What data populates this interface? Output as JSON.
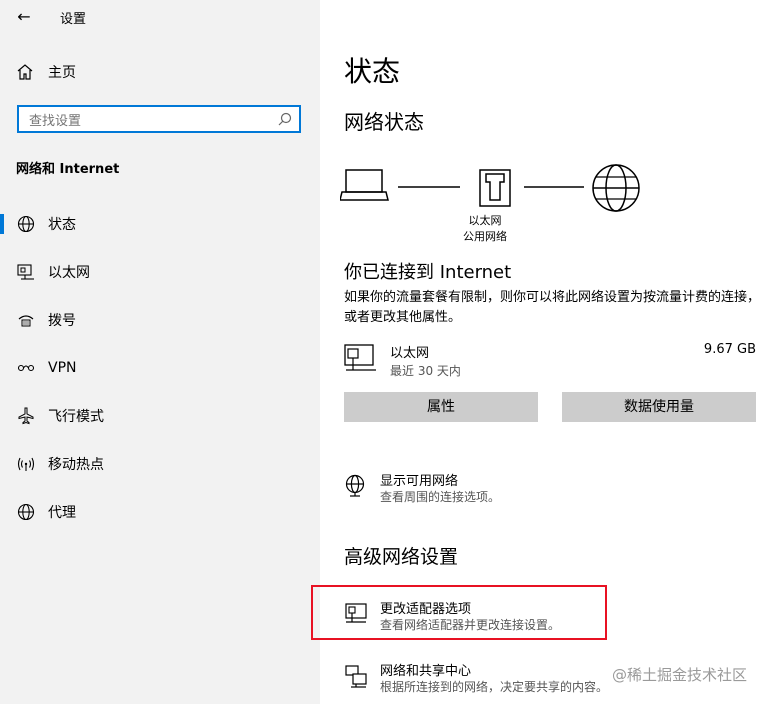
{
  "window": {
    "title": "设置"
  },
  "sidebar": {
    "home_label": "主页",
    "search_placeholder": "查找设置",
    "section_title": "网络和 Internet",
    "items": [
      {
        "label": "状态",
        "icon": "globe-icon",
        "active": true
      },
      {
        "label": "以太网",
        "icon": "ethernet-icon"
      },
      {
        "label": "拨号",
        "icon": "dialup-icon"
      },
      {
        "label": "VPN",
        "icon": "vpn-icon"
      },
      {
        "label": "飞行模式",
        "icon": "airplane-icon"
      },
      {
        "label": "移动热点",
        "icon": "hotspot-icon"
      },
      {
        "label": "代理",
        "icon": "globe-icon"
      }
    ]
  },
  "main": {
    "title": "状态",
    "network_status_heading": "网络状态",
    "diagram": {
      "label_line1": "以太网",
      "label_line2": "公用网络"
    },
    "connected_heading": "你已连接到 Internet",
    "connected_desc": "如果你的流量套餐有限制，则你可以将此网络设置为按流量计费的连接，或者更改其他属性。",
    "ethernet": {
      "name": "以太网",
      "sub": "最近 30 天内",
      "usage": "9.67 GB"
    },
    "buttons": {
      "properties": "属性",
      "data_usage": "数据使用量"
    },
    "show_networks": {
      "title": "显示可用网络",
      "sub": "查看周围的连接选项。"
    },
    "advanced_heading": "高级网络设置",
    "adapter_options": {
      "title": "更改适配器选项",
      "sub": "查看网络适配器并更改连接设置。"
    },
    "sharing_center": {
      "title": "网络和共享中心",
      "sub": "根据所连接到的网络，决定要共享的内容。"
    }
  },
  "watermark": "@稀土掘金技术社区",
  "colors": {
    "accent": "#0078d7",
    "highlight": "#e81123",
    "sidebar_bg": "#f2f2f2"
  }
}
